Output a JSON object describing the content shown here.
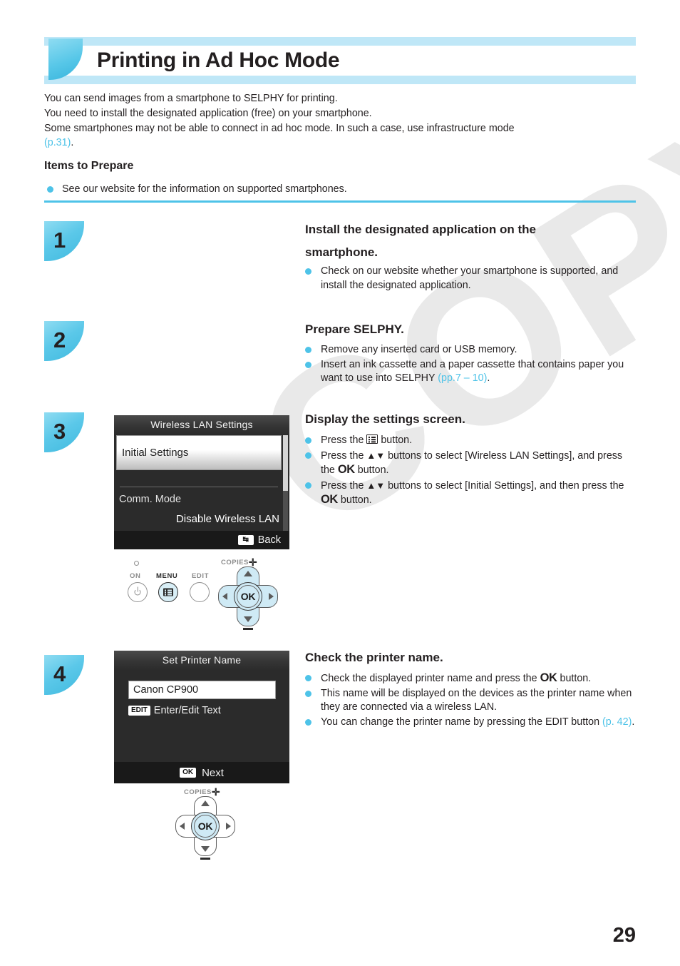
{
  "header": {
    "title": "Printing in Ad Hoc Mode"
  },
  "intro": {
    "line1": "You can send images from a smartphone to SELPHY for printing.",
    "line2": "You need to install the designated application (free) on your smartphone.",
    "line3": "Some smartphones may not be able to connect in ad hoc mode. In such a case, use infrastructure mode",
    "ref": "(p.31)",
    "period": "."
  },
  "items_to_prepare": {
    "heading": "Items to Prepare",
    "bullet": "See our website for the information on supported smartphones."
  },
  "steps": {
    "one": {
      "number": "1",
      "title_line1": "Install the designated application on the",
      "title_line2": "smartphone.",
      "bullets": [
        "Check on our website whether your smartphone is supported, and install the designated application."
      ]
    },
    "two": {
      "number": "2",
      "title": "Prepare SELPHY.",
      "bullet1": "Remove any inserted card or USB memory.",
      "bullet2_a": "Insert an ink cassette and a paper cassette that contains paper you want to use into SELPHY ",
      "bullet2_ref": "(pp.7 – 10)",
      "bullet2_b": "."
    },
    "three": {
      "number": "3",
      "title": "Display the settings screen.",
      "b1_a": "Press the ",
      "b1_b": " button.",
      "b2_a": "Press the ",
      "b2_arrows": "▲▼",
      "b2_b": " buttons to select [Wireless LAN Settings], and press the ",
      "b2_ok": "OK",
      "b2_c": " button.",
      "b3_a": "Press the ",
      "b3_arrows": "▲▼",
      "b3_b": " buttons to select [Initial Settings], and then press the ",
      "b3_ok": "OK",
      "b3_c": " button."
    },
    "four": {
      "number": "4",
      "title": "Check the printer name.",
      "b1_a": "Check the displayed printer name and press the ",
      "b1_ok": "OK",
      "b1_b": " button.",
      "b2": "This name will be displayed on the devices as the printer name when they are connected via a wireless LAN.",
      "b3_a": "You can change the printer name by pressing the EDIT button ",
      "b3_ref": "(p. 42)",
      "b3_b": "."
    }
  },
  "lcd_wireless": {
    "title": "Wireless LAN Settings",
    "selected_item": "Initial Settings",
    "row_label": "Comm. Mode",
    "row_value": "Disable Wireless LAN",
    "footer_key": "↹",
    "footer_label": "Back"
  },
  "lcd_printer_name": {
    "title": "Set Printer Name",
    "field_value": "Canon CP900",
    "edit_key": "EDIT",
    "edit_label": "Enter/Edit Text",
    "footer_key": "OK",
    "footer_label": "Next"
  },
  "control_panel": {
    "on_label": "ON",
    "menu_label": "MENU",
    "edit_label": "EDIT",
    "copies_label": "COPIES"
  },
  "control_panel_small": {
    "copies_label": "COPIES"
  },
  "watermark": "COPY",
  "page_number": "29",
  "colors": {
    "accent": "#4ec3e8",
    "band": "#bfe7f7",
    "text": "#231f20"
  }
}
